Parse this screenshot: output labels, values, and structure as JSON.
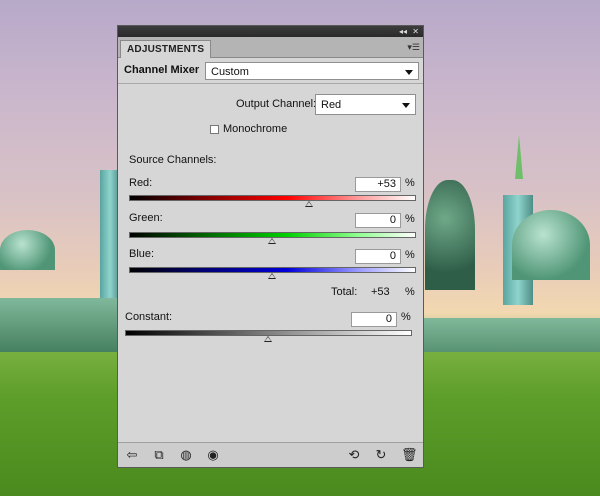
{
  "panel": {
    "tab_label": "ADJUSTMENTS",
    "collapse_icon": "double-chevron-right-icon",
    "close_icon": "close-icon",
    "menu_icon": "panel-menu-icon"
  },
  "header": {
    "label": "Channel Mixer",
    "preset_value": "Custom"
  },
  "output": {
    "label": "Output Channel:",
    "value": "Red"
  },
  "monochrome": {
    "label": "Monochrome",
    "checked": false
  },
  "source": {
    "label": "Source Channels:",
    "channels": [
      {
        "name": "Red:",
        "value": "+53",
        "unit": "%",
        "slider": 53,
        "color": "#ff0000"
      },
      {
        "name": "Green:",
        "value": "0",
        "unit": "%",
        "slider": 0,
        "color": "#00c000"
      },
      {
        "name": "Blue:",
        "value": "0",
        "unit": "%",
        "slider": 0,
        "color": "#0000c8"
      }
    ],
    "total_label": "Total:",
    "total_value": "+53",
    "total_unit": "%"
  },
  "constant": {
    "label": "Constant:",
    "value": "0",
    "unit": "%",
    "slider": 0
  },
  "footer_icons": [
    "back-arrow-icon",
    "clip-to-layer-icon",
    "visibility-toggle-icon",
    "eye-icon",
    "view-previous-state-icon",
    "reset-icon",
    "trash-icon"
  ]
}
